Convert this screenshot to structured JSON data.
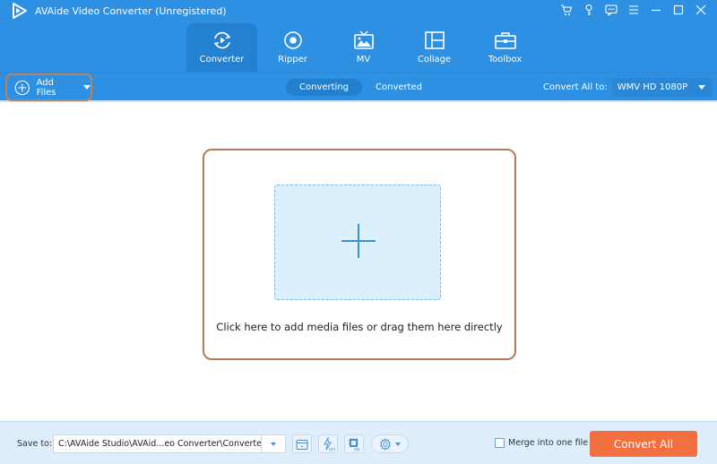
{
  "window": {
    "title": "AVAide Video Converter (Unregistered)",
    "controls": [
      {
        "name": "cart-icon",
        "label": "Purchase"
      },
      {
        "name": "key-icon",
        "label": "Register"
      },
      {
        "name": "chat-icon",
        "label": "Feedback"
      },
      {
        "name": "menu-icon",
        "label": "Menu"
      },
      {
        "name": "minimize-icon",
        "label": "Minimize"
      },
      {
        "name": "maximize-icon",
        "label": "Maximize"
      },
      {
        "name": "close-icon",
        "label": "Close"
      }
    ]
  },
  "nav": {
    "tabs": [
      {
        "label": "Converter",
        "icon": "converter-icon",
        "active": true
      },
      {
        "label": "Ripper",
        "icon": "ripper-icon",
        "active": false
      },
      {
        "label": "MV",
        "icon": "mv-icon",
        "active": false
      },
      {
        "label": "Collage",
        "icon": "collage-icon",
        "active": false
      },
      {
        "label": "Toolbox",
        "icon": "toolbox-icon",
        "active": false
      }
    ]
  },
  "toolbar": {
    "add_files_label": "Add Files",
    "segments": [
      {
        "label": "Converting",
        "active": true
      },
      {
        "label": "Converted",
        "active": false
      }
    ],
    "convert_all_to_label": "Convert All to:",
    "format_value": "WMV HD 1080P"
  },
  "dropzone": {
    "hint": "Click here to add media files or drag them here directly"
  },
  "bottom": {
    "save_to_label": "Save to:",
    "save_path": "C:\\AVAide Studio\\AVAid...eo Converter\\Converted",
    "hw_accel_off_badge": "OFF",
    "gpu_on_badge": "ON",
    "merge_label": "Merge into one file",
    "merge_checked": false,
    "convert_all_label": "Convert All"
  },
  "colors": {
    "brand_blue": "#2d90e3",
    "accent_orange": "#f26f3f",
    "highlight_border": "#b57a5a",
    "bottom_bg": "#dfeefc"
  }
}
